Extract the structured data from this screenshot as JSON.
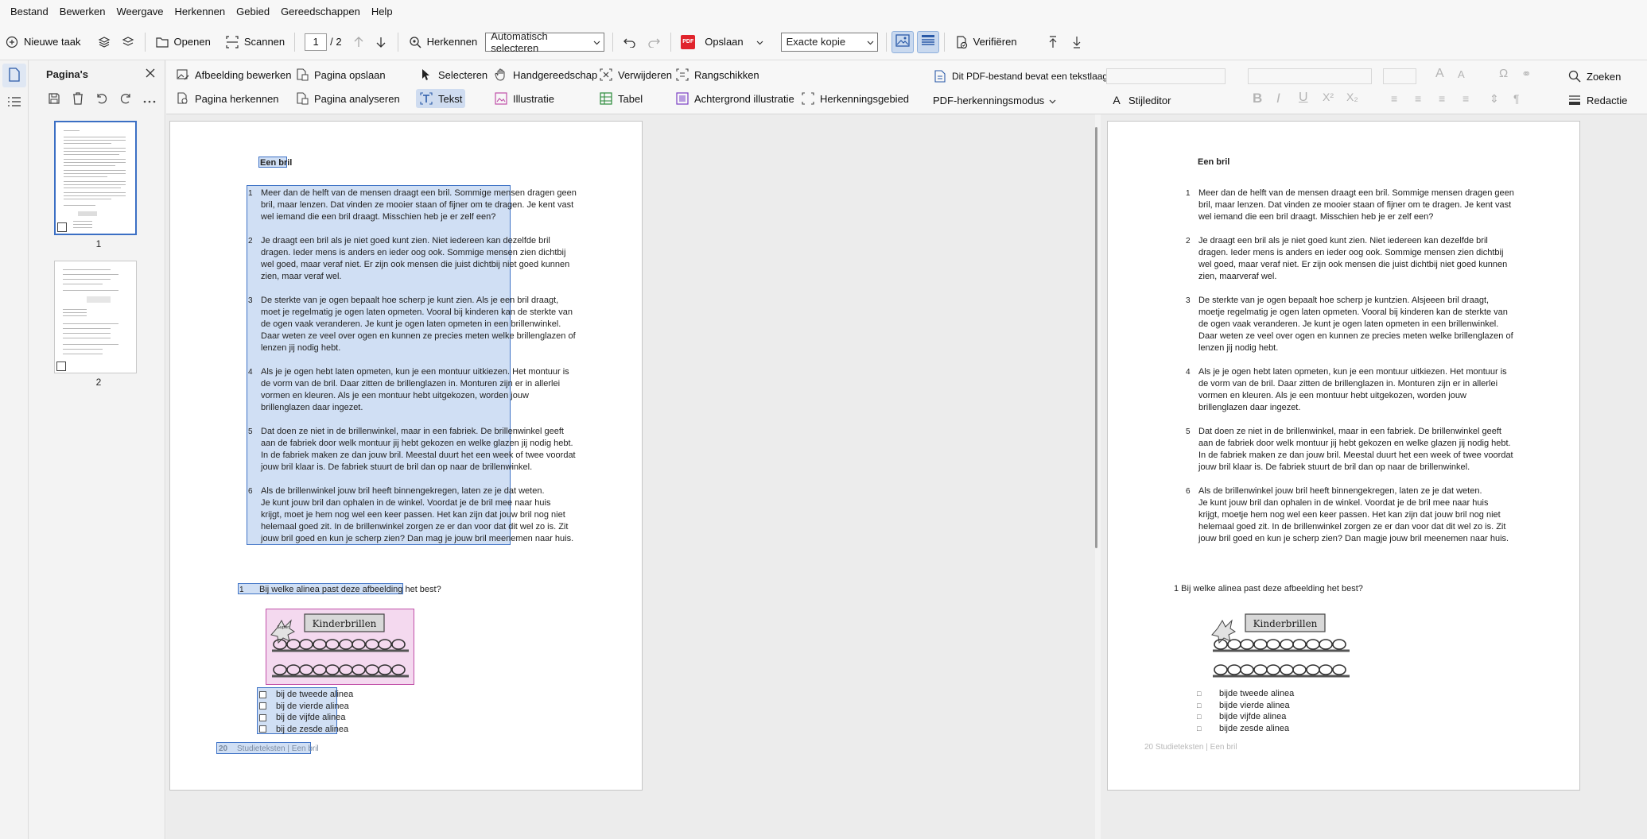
{
  "menu": [
    "Bestand",
    "Bewerken",
    "Weergave",
    "Herkennen",
    "Gebied",
    "Gereedschappen",
    "Help"
  ],
  "toolbar": {
    "new_task": "Nieuwe taak",
    "open": "Openen",
    "scan": "Scannen",
    "page_current": "1",
    "page_total": "/ 2",
    "recognize": "Herkennen",
    "auto_select": "Automatisch selecteren",
    "pdf_badge": "PDF",
    "save": "Opslaan",
    "exact_copy": "Exacte kopie",
    "verify": "Verifiëren"
  },
  "pages_panel": {
    "title": "Pagina's",
    "thumbs": [
      {
        "num": "1"
      },
      {
        "num": "2"
      }
    ]
  },
  "ribbon": {
    "edit_image": "Afbeelding bewerken",
    "save_page": "Pagina opslaan",
    "recognize_page": "Pagina herkennen",
    "analyze_page": "Pagina analyseren",
    "select": "Selecteren",
    "hand_tool": "Handgereedschap",
    "delete": "Verwijderen",
    "arrange": "Rangschikken",
    "text": "Tekst",
    "illustration": "Illustratie",
    "table": "Tabel",
    "background_illustration": "Achtergrond illustratie",
    "recognition_area": "Herkenningsgebied",
    "pdf_text_layer": "Dit PDF-bestand bevat een tekstlaag",
    "pdf_mode": "PDF-herkenningsmodus",
    "style_editor": "Stijleditor",
    "search": "Zoeken",
    "redaction": "Redactie"
  },
  "left_page": {
    "title": "Een bril",
    "paragraphs": [
      {
        "num": "1",
        "text": "Meer dan de helft van de mensen draagt een bril. Sommige mensen dragen geen\nbril, maar lenzen. Dat vinden ze mooier staan of fijner om te dragen. Je kent vast\nwel iemand die een bril draagt. Misschien heb je er zelf een?"
      },
      {
        "num": "2",
        "text": "Je draagt een bril als je niet goed kunt zien. Niet iedereen kan dezelfde bril\ndragen. Ieder mens is anders en ieder oog ook. Sommige mensen zien dichtbij\nwel goed, maar veraf niet. Er zijn ook mensen die juist dichtbij niet goed kunnen\nzien, maar veraf wel."
      },
      {
        "num": "3",
        "text": "De sterkte van je ogen bepaalt hoe scherp je kunt zien. Als je een bril draagt,\nmoet je regelmatig je ogen laten opmeten. Vooral bij kinderen kan de sterkte van\nde ogen vaak veranderen. Je kunt je ogen laten opmeten in een brillenwinkel.\nDaar weten ze veel over ogen en kunnen ze precies meten welke brillenglazen of\nlenzen jij nodig hebt."
      },
      {
        "num": "4",
        "text": "Als je je ogen hebt laten opmeten, kun je een montuur uitkiezen. Het montuur is\nde vorm van de bril. Daar zitten de brillenglazen in. Monturen zijn er in allerlei\nvormen en kleuren. Als je een montuur hebt uitgekozen, worden jouw\nbrillenglazen daar ingezet."
      },
      {
        "num": "5",
        "text": "Dat doen ze niet in de brillenwinkel, maar in een fabriek. De brillenwinkel geeft\naan de fabriek door welk montuur jij hebt gekozen en welke glazen jij nodig hebt.\nIn de fabriek maken ze dan jouw bril. Meestal duurt het een week of twee voordat\njouw bril klaar is. De fabriek stuurt de bril dan op naar de brillenwinkel."
      },
      {
        "num": "6",
        "text": "Als de brillenwinkel jouw bril heeft binnengekregen, laten ze je dat weten.\nJe kunt jouw bril dan ophalen in de winkel. Voordat je de bril mee naar huis\nkrijgt, moet je hem nog wel een keer passen. Het kan zijn dat jouw bril nog niet\nhelemaal goed zit. In de brillenwinkel zorgen ze er dan voor dat dit wel zo is. Zit\njouw bril goed en kun je scherp zien? Dan mag je jouw bril meenemen naar huis."
      }
    ],
    "question_num": "1",
    "question": "Bij welke alinea past deze afbeelding het best?",
    "image_label": "Kinderbrillen",
    "image_badge": "Super",
    "options": [
      "bij de tweede alinea",
      "bij de vierde alinea",
      "bij de vijfde alinea",
      "bij de zesde alinea"
    ],
    "footer_num": "20",
    "footer_text": "Studieteksten | Een bril"
  },
  "right_page": {
    "title": "Een bril",
    "paragraphs": [
      {
        "num": "1",
        "text": "Meer dan de helft van de mensen draagt een bril. Sommige mensen dragen geen\nbril, maar lenzen. Dat vinden ze mooier staan of fijner om te dragen. Je kent vast\nwel iemand die een bril draagt. Misschien heb je er zelf een?"
      },
      {
        "num": "2",
        "text": "Je draagt een bril als je niet goed kunt zien. Niet iedereen kan dezelfde bril\ndragen. Ieder mens is anders en ieder oog ook. Sommige mensen zien dichtbij\nwel goed, maar veraf niet. Er zijn ook mensen die juist dichtbij niet goed kunnen\nzien, maarveraf wel."
      },
      {
        "num": "3",
        "text": "De sterkte van je ogen bepaalt hoe scherp je kuntzien. Alsjeeen bril draagt,\nmoetje regelmatig je ogen laten opmeten. Vooral bij kinderen kan de sterkte van\nde ogen vaak veranderen. Je kunt je ogen laten opmeten in een brillenwinkel.\nDaar weten ze veel over ogen en kunnen ze precies meten welke brillenglazen of\nlenzen jij nodig hebt."
      },
      {
        "num": "4",
        "text": "Als je je ogen hebt laten opmeten, kun je een montuur uitkiezen. Het montuur is\nde vorm van de bril. Daar zitten de brillenglazen in. Monturen zijn er in allerlei\nvormen en kleuren. Als je een montuur hebt uitgekozen, worden jouw\nbrillenglazen daar ingezet."
      },
      {
        "num": "5",
        "text": "Dat doen ze niet in de brillenwinkel, maar in een fabriek. De brillenwinkel geeft\naan de fabriek door welk montuur jij hebt gekozen en welke glazen jij nodig hebt.\nIn de fabriek maken ze dan jouw bril. Meestal duurt het een week of twee voordat\njouw bril klaar is. De fabriek stuurt de bril dan op naar de brillenwinkel."
      },
      {
        "num": "6",
        "text": "Als de brillenwinkel jouw bril heeft binnengekregen, laten ze je dat weten.\nJe kunt jouw bril dan ophalen in de winkel. Voordat je de bril mee naar huis\nkrijgt, moetje hem nog wel een keer passen. Het kan zijn dat jouw bril nog niet\nhelemaal goed zit. In de brillenwinkel zorgen ze er dan voor dat dit wel zo is. Zit\njouw bril goed en kun je scherp zien? Dan magje jouw bril meenemen naar huis."
      }
    ],
    "question": "1 Bij welke alinea past deze afbeelding het best?",
    "image_label": "Kinderbrillen",
    "options": [
      "bijde tweede alinea",
      "bijde vierde alinea",
      "bijde vijfde alinea",
      "bijde zesde alinea"
    ],
    "footer": "20 Studieteksten | Een bril"
  }
}
